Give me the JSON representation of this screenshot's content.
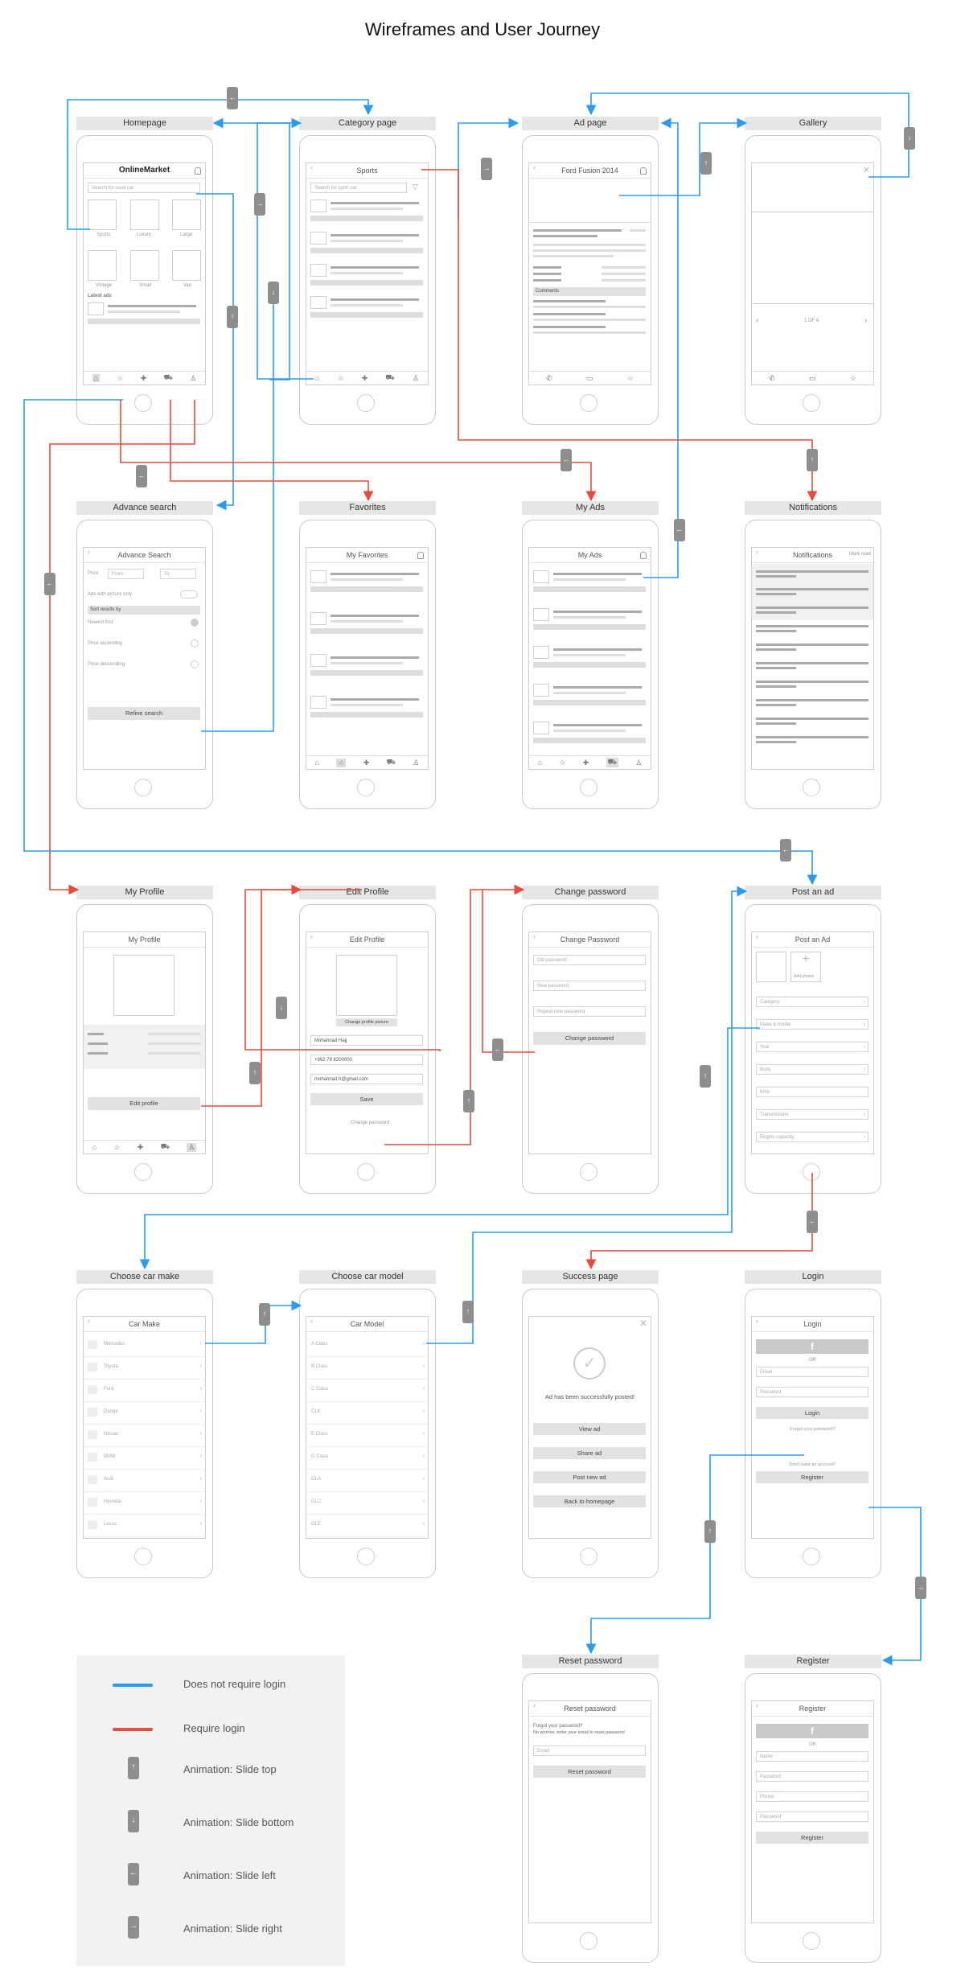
{
  "title": "Wireframes and User Journey",
  "colors": {
    "no_login": "#2b9bf0",
    "login": "#e84a3b",
    "icon": "#8e8e8e"
  },
  "screens": {
    "homepage": {
      "label": "Homepage",
      "app_title": "OnlineMarket",
      "search_placeholder": "Search for used car",
      "tiles": [
        "Sports",
        "Luxury",
        "Large",
        "Vintage",
        "Small",
        "Van"
      ],
      "latest": "Latest ads"
    },
    "category": {
      "label": "Category page",
      "title": "Sports",
      "search_placeholder": "Search for sport car"
    },
    "ad": {
      "label": "Ad page",
      "title": "Ford Fusion 2014",
      "comments": "Comments"
    },
    "gallery": {
      "label": "Gallery",
      "pager": "1 OF 6",
      "close": "✕"
    },
    "advance": {
      "label": "Advance search",
      "title": "Advance Search",
      "price": "Price",
      "from": "From",
      "to": "To",
      "pics_only": "Ads with picture only",
      "sort": "Sort results by",
      "opt1": "Newest first",
      "opt2": "Price ascending",
      "opt3": "Price descending",
      "refine": "Refine search"
    },
    "favorites": {
      "label": "Favorites",
      "title": "My Favorites"
    },
    "myads": {
      "label": "My Ads",
      "title": "My Ads"
    },
    "notifications": {
      "label": "Notifications",
      "title": "Notifications",
      "mark": "Mark read"
    },
    "profile": {
      "label": "My Profile",
      "title": "My Profile",
      "edit": "Edit profile"
    },
    "editprofile": {
      "label": "Edit Profile",
      "title": "Edit Profile",
      "change_pic": "Change profile picture",
      "name": "Mohannad Hajj",
      "phone": "+962 79 8200000",
      "email": "mohannad.h@gmail.com",
      "save": "Save",
      "change_pw": "Change password"
    },
    "changepw": {
      "label": "Change password",
      "title": "Change Password",
      "old": "Old password",
      "new": "New password",
      "repeat": "Repeat new password",
      "btn": "Change password"
    },
    "postad": {
      "label": "Post an ad",
      "title": "Post an Ad",
      "add_photo": "Add photos",
      "fields": [
        "Category",
        "Make & model",
        "Year",
        "Body",
        "Kms",
        "Transmission",
        "Engine capacity"
      ]
    },
    "carmake": {
      "label": "Choose car make",
      "title": "Car Make",
      "items": [
        "Mercedes",
        "Toyota",
        "Ford",
        "Dodge",
        "Nissan",
        "BMW",
        "Audi",
        "Hyundai",
        "Lexus"
      ]
    },
    "carmodel": {
      "label": "Choose car model",
      "title": "Car Model",
      "items": [
        "A Class",
        "B Class",
        "C Class",
        "CLK",
        "E Class",
        "G Class",
        "GLA",
        "GLC",
        "GLE"
      ]
    },
    "success": {
      "label": "Success page",
      "message": "Ad has been successfully posted!",
      "b1": "View ad",
      "b2": "Share ad",
      "b3": "Post new ad",
      "b4": "Back to homepage"
    },
    "login": {
      "label": "Login",
      "title": "Login",
      "or": "OR",
      "email": "Email",
      "password": "Password",
      "btn": "Login",
      "forgot": "Forgot your password?",
      "noacct": "Don't have an account?",
      "register": "Register"
    },
    "reset": {
      "label": "Reset password",
      "title": "Reset password",
      "text1": "Forgot your password?",
      "text2": "No worries, enter your email to reset password",
      "email": "Email",
      "btn": "Reset password"
    },
    "register": {
      "label": "Register",
      "title": "Register",
      "or": "OR",
      "f1": "Name",
      "f2": "Password",
      "f3": "Phone",
      "f4": "Password",
      "btn": "Register"
    }
  },
  "legend": {
    "blue": "Does not require login",
    "red": "Require login",
    "top": "Animation: Slide top",
    "bottom": "Animation: Slide bottom",
    "left": "Animation: Slide left",
    "right": "Animation: Slide right"
  }
}
